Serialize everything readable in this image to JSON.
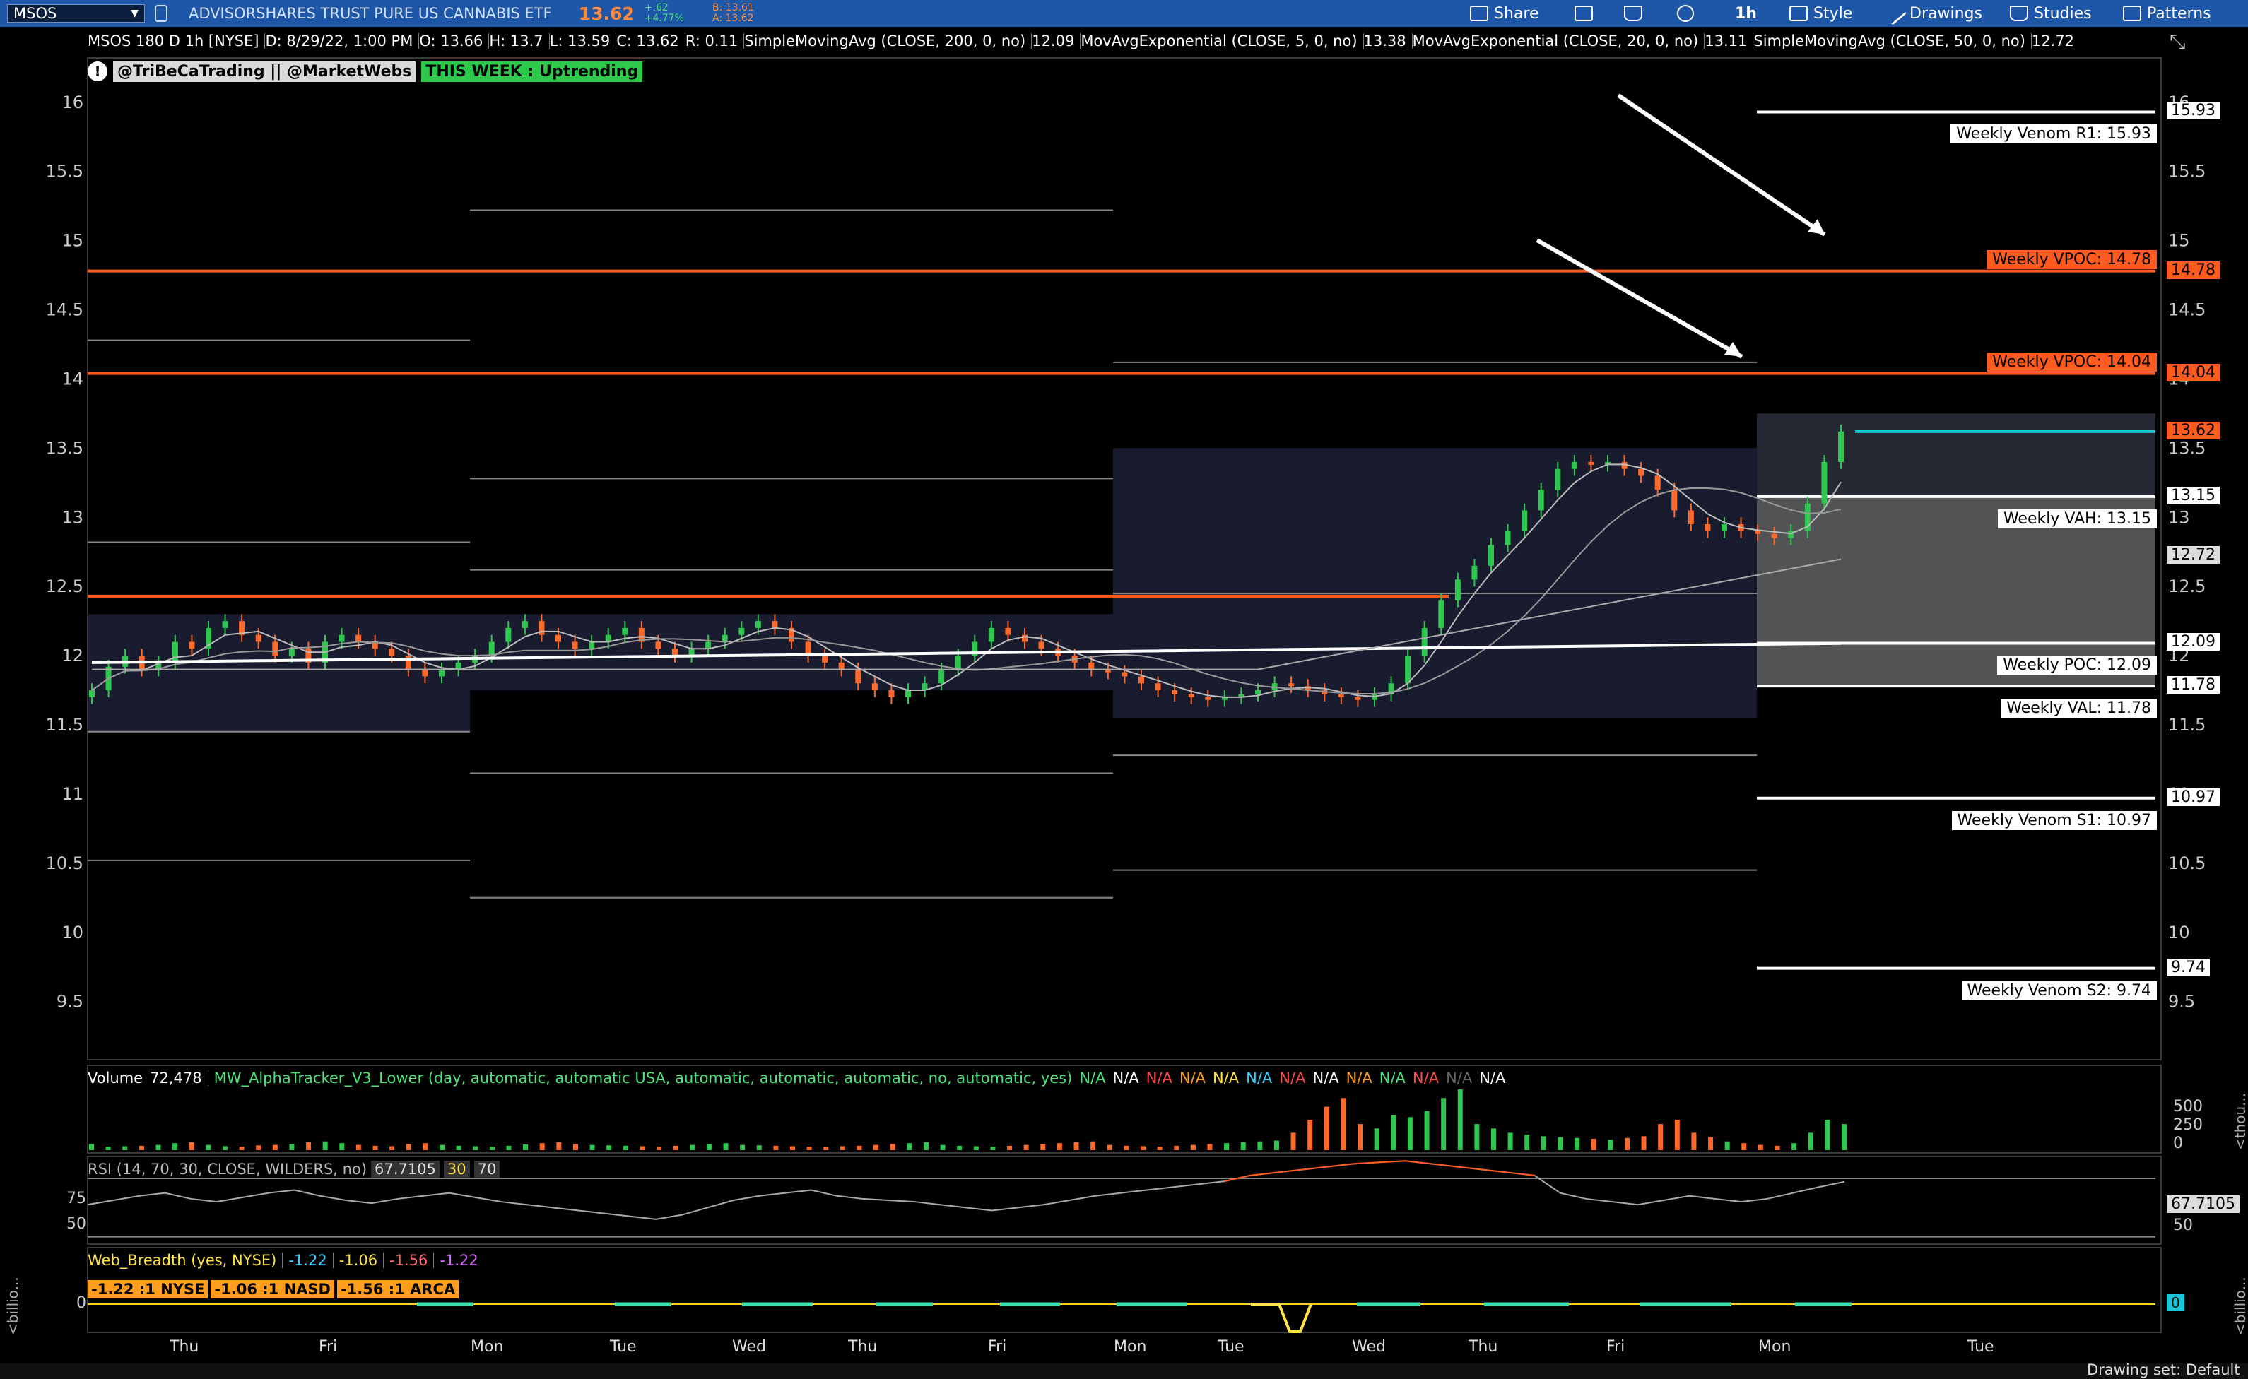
{
  "toolbar": {
    "symbol": "MSOS",
    "description": "ADVISORSHARES TRUST PURE US CANNABIS ETF",
    "last": "13.62",
    "change": "+.62",
    "change_pct": "+4.77%",
    "bid": "B: 13.61",
    "ask": "A: 13.62",
    "share_label": "Share",
    "interval_label": "1h",
    "style_label": "Style",
    "drawings_label": "Drawings",
    "studies_label": "Studies",
    "patterns_label": "Patterns"
  },
  "infobar": {
    "title": "MSOS 180 D 1h [NYSE]",
    "date": "D: 8/29/22, 1:00 PM",
    "open": "O: 13.66",
    "high": "H: 13.7",
    "low": "L: 13.59",
    "close": "C: 13.62",
    "range": "R: 0.11",
    "study1": "SimpleMovingAvg (CLOSE, 200, 0, no)",
    "study1_val": "12.09",
    "study2": "MovAvgExponential (CLOSE, 5, 0, no)",
    "study2_val": "13.38",
    "study3": "MovAvgExponential (CLOSE, 20, 0, no)",
    "study3_val": "13.11",
    "study4": "SimpleMovingAvg (CLOSE, 50, 0, no)",
    "study4_val": "12.72"
  },
  "alert": {
    "icon": "!",
    "handles": "@TriBeCaTrading || @MarketWebs",
    "trend": "THIS WEEK : Uptrending"
  },
  "levels": [
    {
      "label": "Weekly Venom R1: 15.93",
      "tag": "15.93",
      "price": 15.93,
      "style": "white"
    },
    {
      "label": "Weekly VPOC: 14.78",
      "tag": "14.78",
      "price": 14.78,
      "style": "orange"
    },
    {
      "label": "Weekly VPOC: 14.04",
      "tag": "14.04",
      "price": 14.04,
      "style": "orange"
    },
    {
      "label": "Weekly VAH: 13.15",
      "tag": "13.15",
      "price": 13.15,
      "style": "white"
    },
    {
      "label": "Weekly POC: 12.09",
      "tag": "12.09",
      "price": 12.09,
      "style": "white"
    },
    {
      "label": "Weekly VAL: 11.78",
      "tag": "11.78",
      "price": 11.78,
      "style": "white"
    },
    {
      "label": "Weekly Venom S1: 10.97",
      "tag": "10.97",
      "price": 10.97,
      "style": "white"
    },
    {
      "label": "Weekly Venom S2: 9.74",
      "tag": "9.74",
      "price": 9.74,
      "style": "white"
    }
  ],
  "price_tags": {
    "last": "13.62",
    "sma50": "12.72"
  },
  "volume_panel": {
    "label": "Volume",
    "value": "72,478",
    "study": "MW_AlphaTracker_V3_Lower (day, automatic, automatic USA, automatic, automatic, automatic, no, automatic, yes)",
    "na_items": [
      {
        "text": "N/A",
        "color": "#4fe37a"
      },
      {
        "text": "N/A",
        "color": "#ffffff"
      },
      {
        "text": "N/A",
        "color": "#ff4a4a"
      },
      {
        "text": "N/A",
        "color": "#ff9d1f"
      },
      {
        "text": "N/A",
        "color": "#ffe14a"
      },
      {
        "text": "N/A",
        "color": "#35d0ff"
      },
      {
        "text": "N/A",
        "color": "#ff4a4a"
      },
      {
        "text": "N/A",
        "color": "#ffffff"
      },
      {
        "text": "N/A",
        "color": "#ff9d1f"
      },
      {
        "text": "N/A",
        "color": "#4fe37a"
      },
      {
        "text": "N/A",
        "color": "#ff4a4a"
      },
      {
        "text": "N/A",
        "color": "#666666"
      },
      {
        "text": "N/A",
        "color": "#ffffff"
      }
    ],
    "axis": [
      "500",
      "250",
      "0"
    ],
    "unit": "<thou..."
  },
  "rsi_panel": {
    "label": "RSI (14, 70, 30, CLOSE, WILDERS, no)",
    "value": "67.7105",
    "lower": "30",
    "upper": "70",
    "axis": [
      "75",
      "50"
    ],
    "tag": "67.7105",
    "tag_low": "50"
  },
  "breadth_panel": {
    "label": "Web_Breadth (yes, NYSE)",
    "v1": "-1.22",
    "v2": "-1.06",
    "v3": "-1.56",
    "v4": "-1.22",
    "boxes": [
      "-1.22 :1 NYSE",
      "-1.06 :1 NASD",
      "-1.56 :1 ARCA"
    ],
    "axis_zero": "0",
    "tag": "0",
    "unit_left": "<billio...",
    "unit_right": "<billio..."
  },
  "x_days": [
    "Thu",
    "Fri",
    "Mon",
    "Tue",
    "Wed",
    "Thu",
    "Fri",
    "Mon",
    "Tue",
    "Wed",
    "Thu",
    "Fri",
    "Mon",
    "Tue"
  ],
  "status": {
    "drawing_set": "Drawing set: Default"
  },
  "colors": {
    "up": "#2fc74f",
    "down": "#ff6a2a",
    "vpoc": "#ff5a1f",
    "last_line": "#19c8d6"
  },
  "chart_data": {
    "type": "candlestick",
    "ylim": [
      9.1,
      16.3
    ],
    "y_ticks": [
      9.5,
      10,
      10.5,
      11,
      11.5,
      12,
      12.5,
      13,
      13.5,
      14,
      14.5,
      15,
      15.5,
      16
    ],
    "x_categories": [
      "Thu",
      "Fri",
      "Mon",
      "Tue",
      "Wed",
      "Thu",
      "Fri",
      "Mon",
      "Tue",
      "Wed",
      "Thu",
      "Fri",
      "Mon",
      "Tue"
    ],
    "close": [
      11.75,
      11.92,
      12.0,
      11.9,
      11.95,
      12.1,
      12.05,
      12.2,
      12.25,
      12.15,
      12.1,
      12.0,
      12.05,
      11.95,
      12.1,
      12.15,
      12.1,
      12.05,
      12.0,
      11.9,
      11.85,
      11.9,
      11.95,
      12.0,
      12.1,
      12.2,
      12.25,
      12.15,
      12.1,
      12.05,
      12.1,
      12.15,
      12.2,
      12.1,
      12.05,
      12.0,
      12.05,
      12.1,
      12.15,
      12.2,
      12.25,
      12.2,
      12.1,
      12.0,
      11.95,
      11.9,
      11.8,
      11.75,
      11.7,
      11.75,
      11.8,
      11.9,
      12.0,
      12.1,
      12.2,
      12.15,
      12.1,
      12.05,
      12.0,
      11.95,
      11.9,
      11.88,
      11.85,
      11.8,
      11.75,
      11.72,
      11.7,
      11.68,
      11.7,
      11.72,
      11.75,
      11.8,
      11.78,
      11.75,
      11.72,
      11.7,
      11.68,
      11.72,
      11.8,
      12.0,
      12.2,
      12.4,
      12.55,
      12.65,
      12.8,
      12.9,
      13.05,
      13.2,
      13.35,
      13.4,
      13.38,
      13.4,
      13.35,
      13.3,
      13.2,
      13.05,
      12.95,
      12.9,
      12.95,
      12.9,
      12.88,
      12.85,
      12.9,
      13.1,
      13.4,
      13.62
    ],
    "volume_approx": [
      70,
      40,
      45,
      50,
      60,
      80,
      90,
      60,
      45,
      40,
      55,
      60,
      70,
      90,
      100,
      80,
      60,
      50,
      45,
      70,
      80,
      60,
      50,
      45,
      40,
      50,
      65,
      80,
      90,
      70,
      60,
      55,
      50,
      45,
      40,
      50,
      60,
      70,
      80,
      60,
      55,
      50,
      45,
      40,
      35,
      45,
      50,
      60,
      70,
      80,
      90,
      60,
      50,
      45,
      40,
      50,
      60,
      70,
      80,
      90,
      100,
      60,
      50,
      45,
      40,
      50,
      60,
      70,
      80,
      90,
      100,
      110,
      200,
      350,
      500,
      600,
      300,
      250,
      400,
      380,
      450,
      600,
      700,
      300,
      250,
      200,
      180,
      160,
      150,
      140,
      130,
      120,
      140,
      160,
      300,
      350,
      200,
      150,
      100,
      80,
      60,
      50,
      80,
      200,
      350,
      300
    ],
    "rsi_approx": [
      52,
      55,
      58,
      60,
      56,
      54,
      57,
      60,
      62,
      58,
      55,
      53,
      56,
      58,
      60,
      57,
      54,
      52,
      50,
      48,
      46,
      44,
      42,
      45,
      50,
      55,
      58,
      60,
      62,
      58,
      56,
      55,
      54,
      52,
      50,
      48,
      50,
      52,
      55,
      58,
      60,
      62,
      64,
      66,
      68,
      72,
      74,
      76,
      78,
      80,
      81,
      82,
      80,
      78,
      76,
      74,
      72,
      60,
      56,
      54,
      52,
      55,
      58,
      56,
      54,
      56,
      60,
      64,
      67.71
    ]
  }
}
